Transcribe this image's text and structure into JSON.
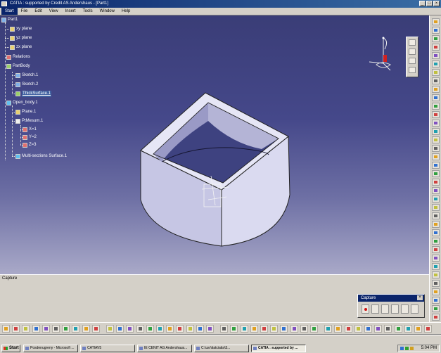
{
  "window": {
    "title": "CATIA : supported by Credit AS Andershaus - [Part1]",
    "min": "_",
    "max": "□",
    "close": "×"
  },
  "menu": [
    "Start",
    "File",
    "Edit",
    "View",
    "Insert",
    "Tools",
    "Window",
    "Help"
  ],
  "tree": {
    "root": "Part1",
    "xy_plane": "xy plane",
    "yz_plane": "yz plane",
    "zx_plane": "zx plane",
    "relations": "Relations",
    "partbody": "PartBody",
    "sketch1": "Sketch.1",
    "sketch2": "Sketch.2",
    "thicksurface": "ThickSurface.1",
    "openbody": "Open_body.1",
    "plane1": "Plane.1",
    "ptsystem": "PtMesum.1",
    "x": "X=1",
    "y": "Y=2",
    "z": "Z=3",
    "multisection": "Multi-sections Surface.1"
  },
  "status": {
    "text": "Capture"
  },
  "capture_toolbar": {
    "title": "Capture",
    "close": "×"
  },
  "taskbar": {
    "start": "Start",
    "tasks": [
      "Posdenugreny - Microsoft ...",
      "CATIAV5",
      "IE CENIT AG Andershaus...",
      "C:\\usr\\tiatciatia\\5...",
      "CATIA : supported by ..."
    ],
    "clock": "5:04 PM"
  },
  "colors": {
    "viewport_top": "#3a3d77",
    "viewport_bottom": "#a9a9c8",
    "part_fill": "#c9c9e6",
    "titlebar": "#0a246a"
  }
}
